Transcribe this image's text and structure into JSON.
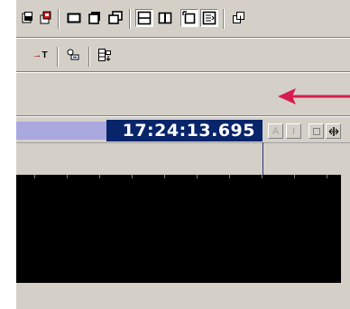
{
  "toolbar1": {
    "icons": [
      "stack-icon",
      "stack-red-icon",
      "frame-icon",
      "frame-shadow-icon",
      "frame-double-icon",
      "split-horizontal-icon",
      "split-vertical-icon",
      "link-frame-icon",
      "list-frame-icon",
      "grid-icon"
    ]
  },
  "toolbar2": {
    "marker_label": "T",
    "icons": [
      "marker-icon",
      "key-link-icon",
      "grid-down-icon"
    ]
  },
  "colors": {
    "arrow": "#d61c4e",
    "timecode_bg": "#08246b",
    "timeline_fill": "#a9a8df"
  },
  "timeline": {
    "timecode": "17:24:13.695",
    "btn_a": "A",
    "btn_i": "I"
  }
}
